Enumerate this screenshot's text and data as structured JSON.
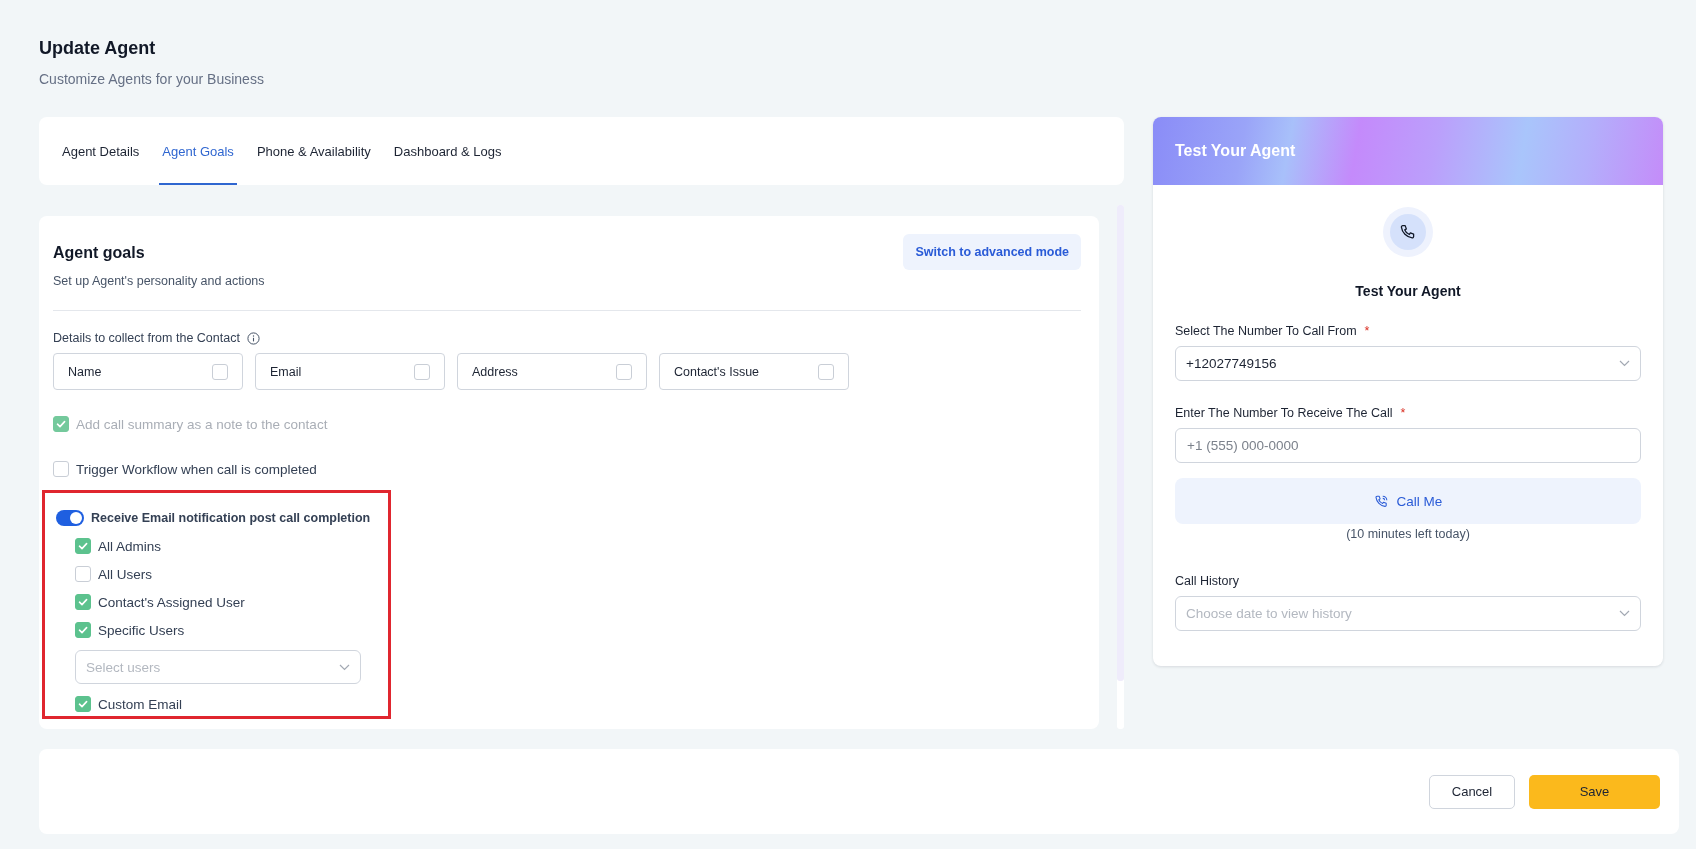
{
  "header": {
    "title": "Update Agent",
    "subtitle": "Customize Agents for your Business"
  },
  "tabs": [
    {
      "label": "Agent Details",
      "selected": false
    },
    {
      "label": "Agent Goals",
      "selected": true
    },
    {
      "label": "Phone & Availability",
      "selected": false
    },
    {
      "label": "Dashboard & Logs",
      "selected": false
    }
  ],
  "goals": {
    "title": "Agent goals",
    "subtitle": "Set up Agent's personality and actions",
    "advanced_button": "Switch to advanced mode",
    "details_label": "Details to collect from the Contact",
    "details": [
      {
        "label": "Name",
        "checked": false
      },
      {
        "label": "Email",
        "checked": false
      },
      {
        "label": "Address",
        "checked": false
      },
      {
        "label": "Contact's Issue",
        "checked": false
      }
    ],
    "options": [
      {
        "label": "Add call summary as a note to the contact",
        "checked": true,
        "disabled": true
      },
      {
        "label": "Trigger Workflow when call is completed",
        "checked": false,
        "disabled": false
      }
    ],
    "notification": {
      "label": "Receive Email notification post call completion",
      "on": true,
      "recipients": [
        {
          "kind": "checkbox",
          "label": "All Admins",
          "checked": true
        },
        {
          "kind": "checkbox",
          "label": "All Users",
          "checked": false
        },
        {
          "kind": "checkbox",
          "label": "Contact's Assigned User",
          "checked": true
        },
        {
          "kind": "checkbox",
          "label": "Specific Users",
          "checked": true
        },
        {
          "kind": "select",
          "placeholder": "Select users"
        },
        {
          "kind": "checkbox",
          "label": "Custom Email",
          "checked": true
        }
      ]
    }
  },
  "test_panel": {
    "header_title": "Test Your Agent",
    "title": "Test Your Agent",
    "from_label": "Select The Number To Call From",
    "from_required": "*",
    "from_value": "+12027749156",
    "to_label": "Enter The Number To Receive The Call",
    "to_required": "*",
    "to_placeholder": "+1 (555) 000-0000",
    "call_button": "Call Me",
    "minutes_left": "(10 minutes left today)",
    "history_label": "Call History",
    "history_placeholder": "Choose date to view history"
  },
  "footer": {
    "cancel": "Cancel",
    "save": "Save"
  }
}
